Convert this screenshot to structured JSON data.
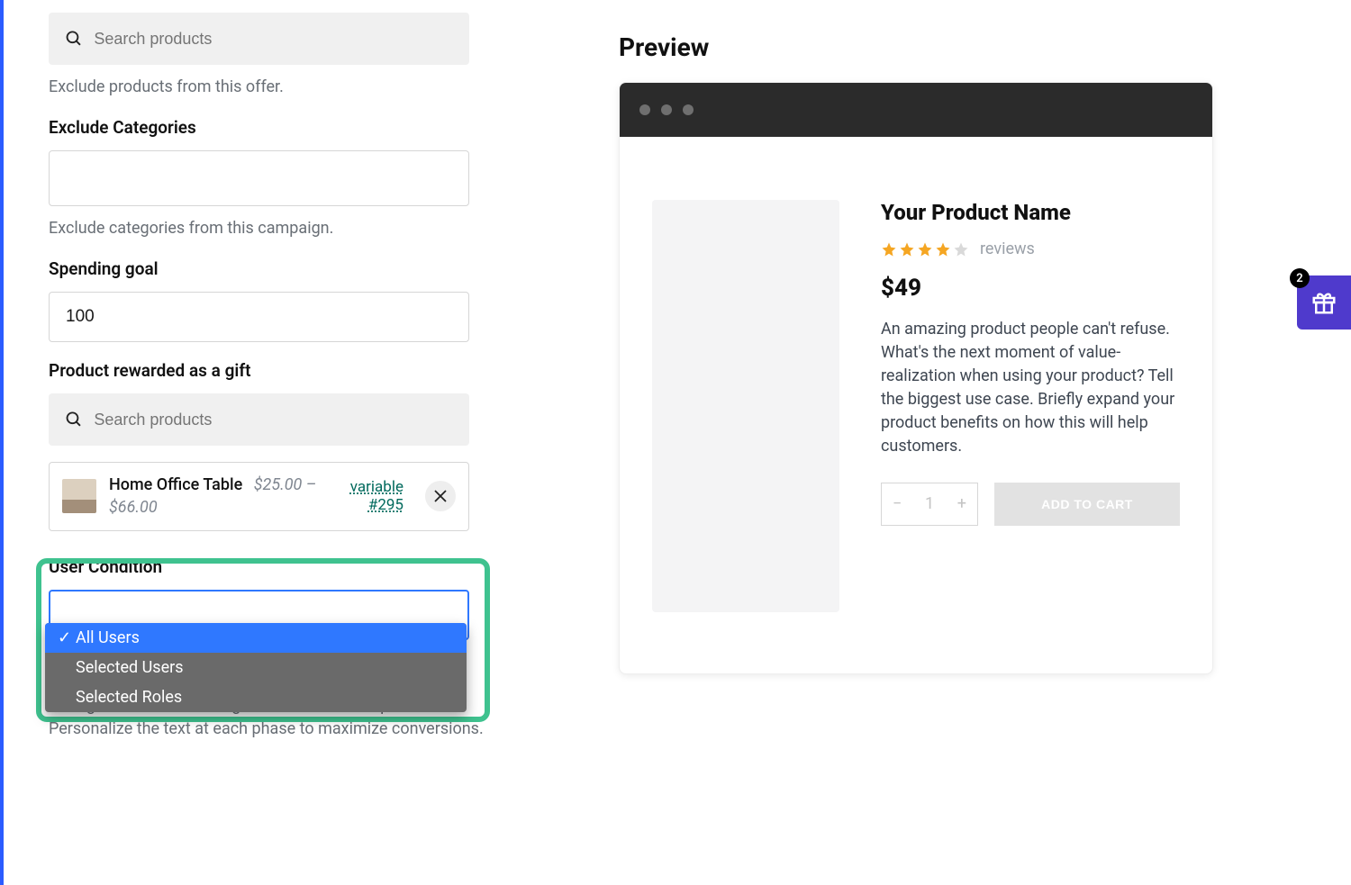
{
  "left": {
    "excludeProducts": {
      "placeholder": "Search products",
      "help": "Exclude products from this offer."
    },
    "excludeCategories": {
      "label": "Exclude Categories",
      "help": "Exclude categories from this campaign."
    },
    "spendingGoal": {
      "label": "Spending goal",
      "value": "100"
    },
    "reward": {
      "label": "Product rewarded as a gift",
      "placeholder": "Search products",
      "product": {
        "name": "Home Office Table",
        "price": "$25.00 – $66.00",
        "type": "variable",
        "id": "#295"
      }
    },
    "userCondition": {
      "label": "User Condition",
      "options": [
        "All Users",
        "Selected Users",
        "Selected Roles"
      ],
      "selected": "All Users"
    },
    "spendingText": {
      "help": "Configure the text for the gift offer across five phases. Personalize the text at each phase to maximize conversions."
    }
  },
  "preview": {
    "title": "Preview",
    "productName": "Your Product Name",
    "reviewsLabel": "reviews",
    "price": "$49",
    "description": "An amazing product people can't refuse. What's the next moment of value-realization when using your product? Tell the biggest use case. Briefly expand your product benefits on how this will help customers.",
    "qty": "1",
    "addToCart": "ADD TO CART",
    "giftCount": "2"
  }
}
